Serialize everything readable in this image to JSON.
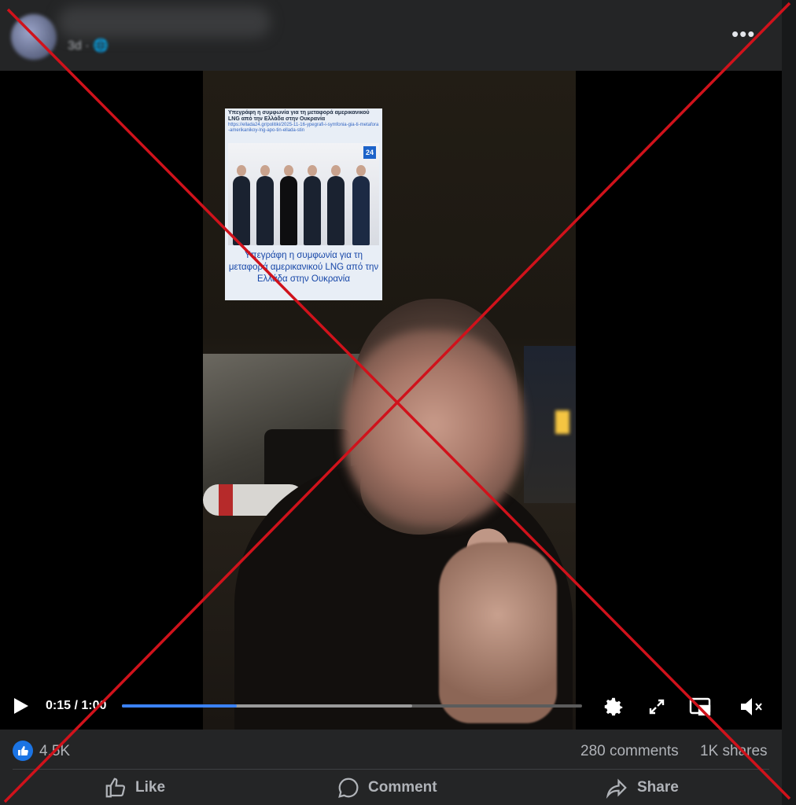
{
  "post": {
    "author_name": "",
    "timestamp": "3d",
    "more_label": "•••"
  },
  "video": {
    "overlay_article": {
      "title": "Υπεγράφη η συμφωνία για τη μεταφορά αμερικανικού LNG από την Ελλάδα στην Ουκρανία",
      "link": "https://ellada24.gr/politiki/2025-11-16-ypegrafi-i-symfonia-gia-ti-metafora-amerikanikoy-lng-apo-tin-ellada-stin",
      "logo": "24",
      "caption": "Υπεγράφη η συμφωνία για τη μεταφορά αμερικανικού LNG από την Ελλάδα στην Ουκρανία"
    },
    "time_display": "0:15 / 1:00",
    "progress": 0.25,
    "buffered": 0.63
  },
  "stats": {
    "reactions": "4.5K",
    "comments": "280 comments",
    "shares": "1K shares"
  },
  "actions": {
    "like": "Like",
    "comment": "Comment",
    "share": "Share"
  },
  "colors": {
    "accent": "#1b74e4",
    "progress": "#3b82f6",
    "cross": "#d0121b"
  }
}
